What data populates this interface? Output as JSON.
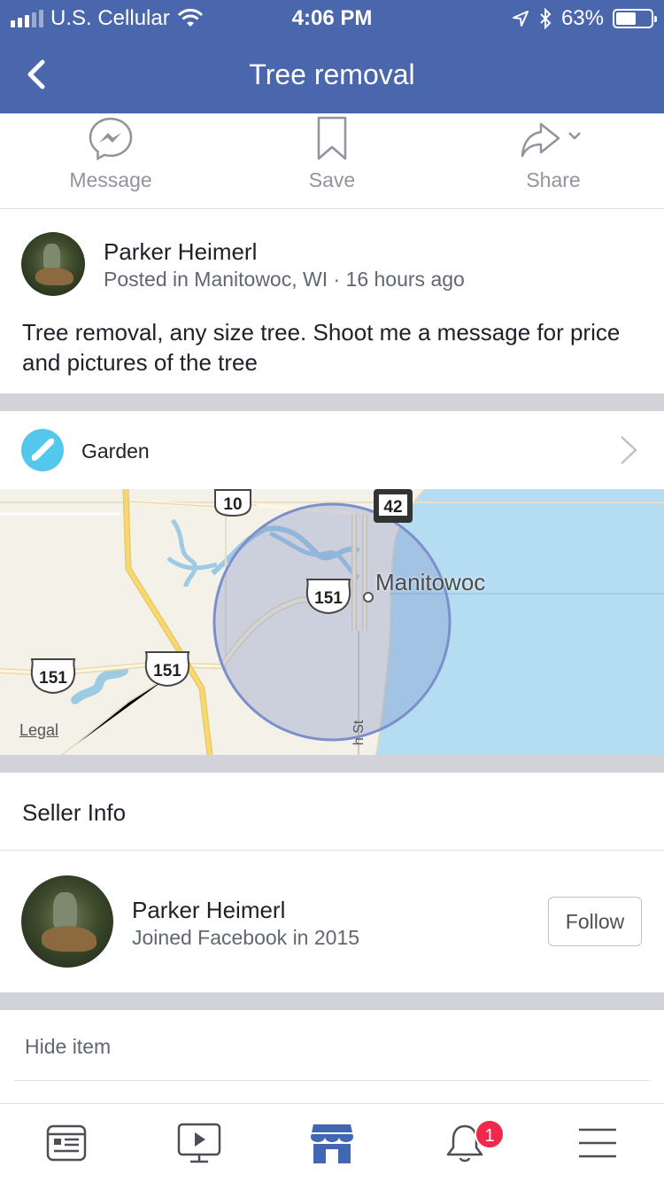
{
  "status_bar": {
    "carrier": "U.S. Cellular",
    "time": "4:06 PM",
    "battery": "63%",
    "battery_level": 0.63,
    "icons": [
      "signal-icon",
      "wifi-icon",
      "location-icon",
      "bluetooth-icon",
      "battery-icon"
    ]
  },
  "nav": {
    "title": "Tree removal",
    "back_icon": "chevron-left-icon"
  },
  "actions": [
    {
      "label": "Message",
      "icon": "messenger-icon"
    },
    {
      "label": "Save",
      "icon": "bookmark-icon"
    },
    {
      "label": "Share",
      "icon": "share-icon"
    }
  ],
  "post": {
    "author": "Parker Heimerl",
    "meta": "Posted in Manitowoc, WI · 16 hours ago",
    "description": "Tree removal, any size tree. Shoot me a message for price and pictures of the tree"
  },
  "category": {
    "label": "Garden",
    "icon": "shovel-icon",
    "color": "#54c7ec"
  },
  "map": {
    "city": "Manitowoc",
    "legal": "Legal",
    "street": "h St",
    "route_shields": [
      "10",
      "42",
      "151",
      "151",
      "151"
    ]
  },
  "seller_info": {
    "heading": "Seller Info",
    "name": "Parker Heimerl",
    "joined": "Joined Facebook in 2015",
    "follow_label": "Follow"
  },
  "hide_item": "Hide item",
  "tab_bar": {
    "tabs": [
      {
        "name": "news-feed",
        "icon": "news-feed-icon"
      },
      {
        "name": "watch",
        "icon": "video-icon"
      },
      {
        "name": "marketplace",
        "icon": "marketplace-icon",
        "active": true
      },
      {
        "name": "notifications",
        "icon": "bell-icon",
        "badge": "1"
      },
      {
        "name": "menu",
        "icon": "menu-icon"
      }
    ]
  },
  "colors": {
    "brand": "#4a66ad",
    "active_tab": "#4267b2",
    "badge": "#f02849",
    "water": "#b5ddf2"
  }
}
